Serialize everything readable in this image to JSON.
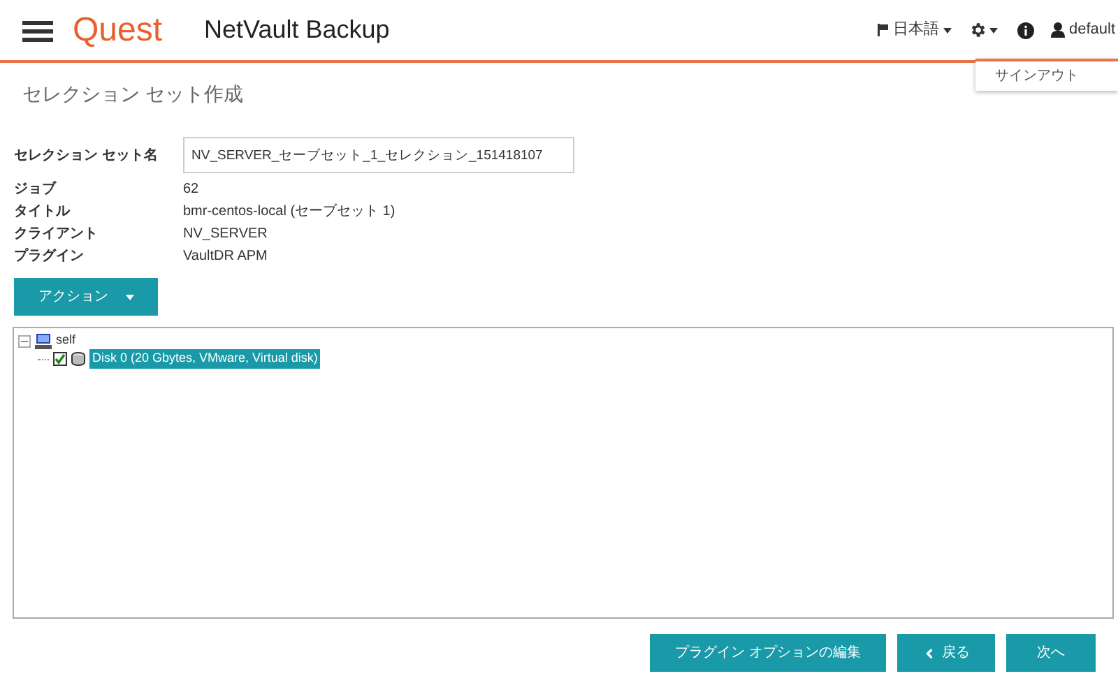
{
  "header": {
    "brand": "Quest",
    "product": "NetVault Backup",
    "language": "日本語",
    "user": "default",
    "user_menu": [
      "サインアウト"
    ]
  },
  "page_title": "セレクション セット作成",
  "form": {
    "name_label": "セレクション セット名",
    "name_value": "NV_SERVER_セーブセット_1_セレクション_151418107",
    "fields": [
      {
        "label": "ジョブ",
        "value": "62"
      },
      {
        "label": "タイトル",
        "value": "bmr-centos-local (セーブセット 1)"
      },
      {
        "label": "クライアント",
        "value": "NV_SERVER"
      },
      {
        "label": "プラグイン",
        "value": "VaultDR APM"
      }
    ]
  },
  "action_button": "アクション",
  "tree": [
    {
      "label": "self",
      "expanded": true,
      "children": [
        {
          "label": "Disk 0 (20 Gbytes, VMware, Virtual disk)",
          "checked": true,
          "selected": true
        }
      ]
    }
  ],
  "buttons": [
    {
      "kind": "plain",
      "label": "プラグイン オプションの編集"
    },
    {
      "kind": "back",
      "label": "戻る"
    },
    {
      "kind": "plain",
      "label": "次へ"
    }
  ]
}
